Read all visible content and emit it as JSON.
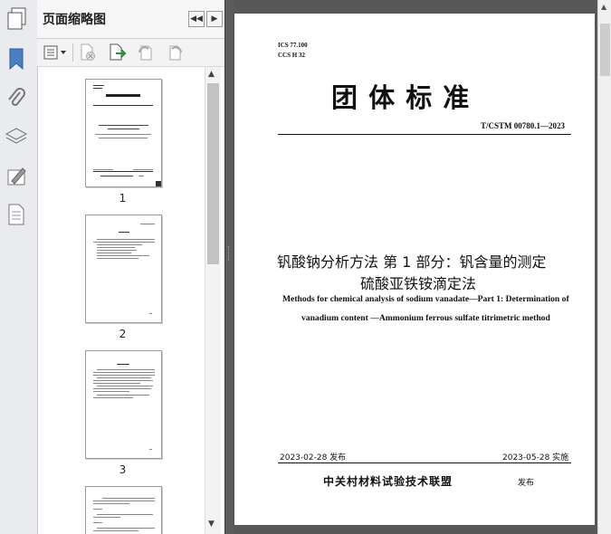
{
  "panel": {
    "title": "页面缩略图",
    "nav_prev": "◀◀",
    "nav_next": "▶"
  },
  "thumbnails": [
    {
      "page": "1"
    },
    {
      "page": "2"
    },
    {
      "page": "3"
    }
  ],
  "document": {
    "ics": "ICS 77.100",
    "ccs": "CCS H 32",
    "heading": "团 体 标 准",
    "standard_no": "T/CSTM 00780.1—2023",
    "title_cn_line1": "钒酸钠分析方法  第 1 部分：钒含量的测定",
    "title_cn_line2": "硫酸亚铁铵滴定法",
    "title_en_line1": "Methods for chemical analysis of sodium vanadate—Part 1: Determination of",
    "title_en_line2": "vanadium content —Ammonium ferrous sulfate titrimetric method",
    "release_date": "2023-02-28 发布",
    "implement_date": "2023-05-28  实施",
    "publisher": "中关村材料试验技术联盟",
    "publish_label": "发布"
  },
  "colors": {
    "rail_bg": "#e9ebee",
    "doc_bg": "#585858",
    "bookmark_blue": "#4a7fc1"
  },
  "icons": [
    "pages-icon",
    "bookmark-icon",
    "attachment-icon",
    "layers-icon",
    "signature-icon",
    "document-icon",
    "options-menu-icon",
    "delete-page-icon",
    "insert-page-icon",
    "rotate-ccw-icon",
    "rotate-cw-icon"
  ]
}
